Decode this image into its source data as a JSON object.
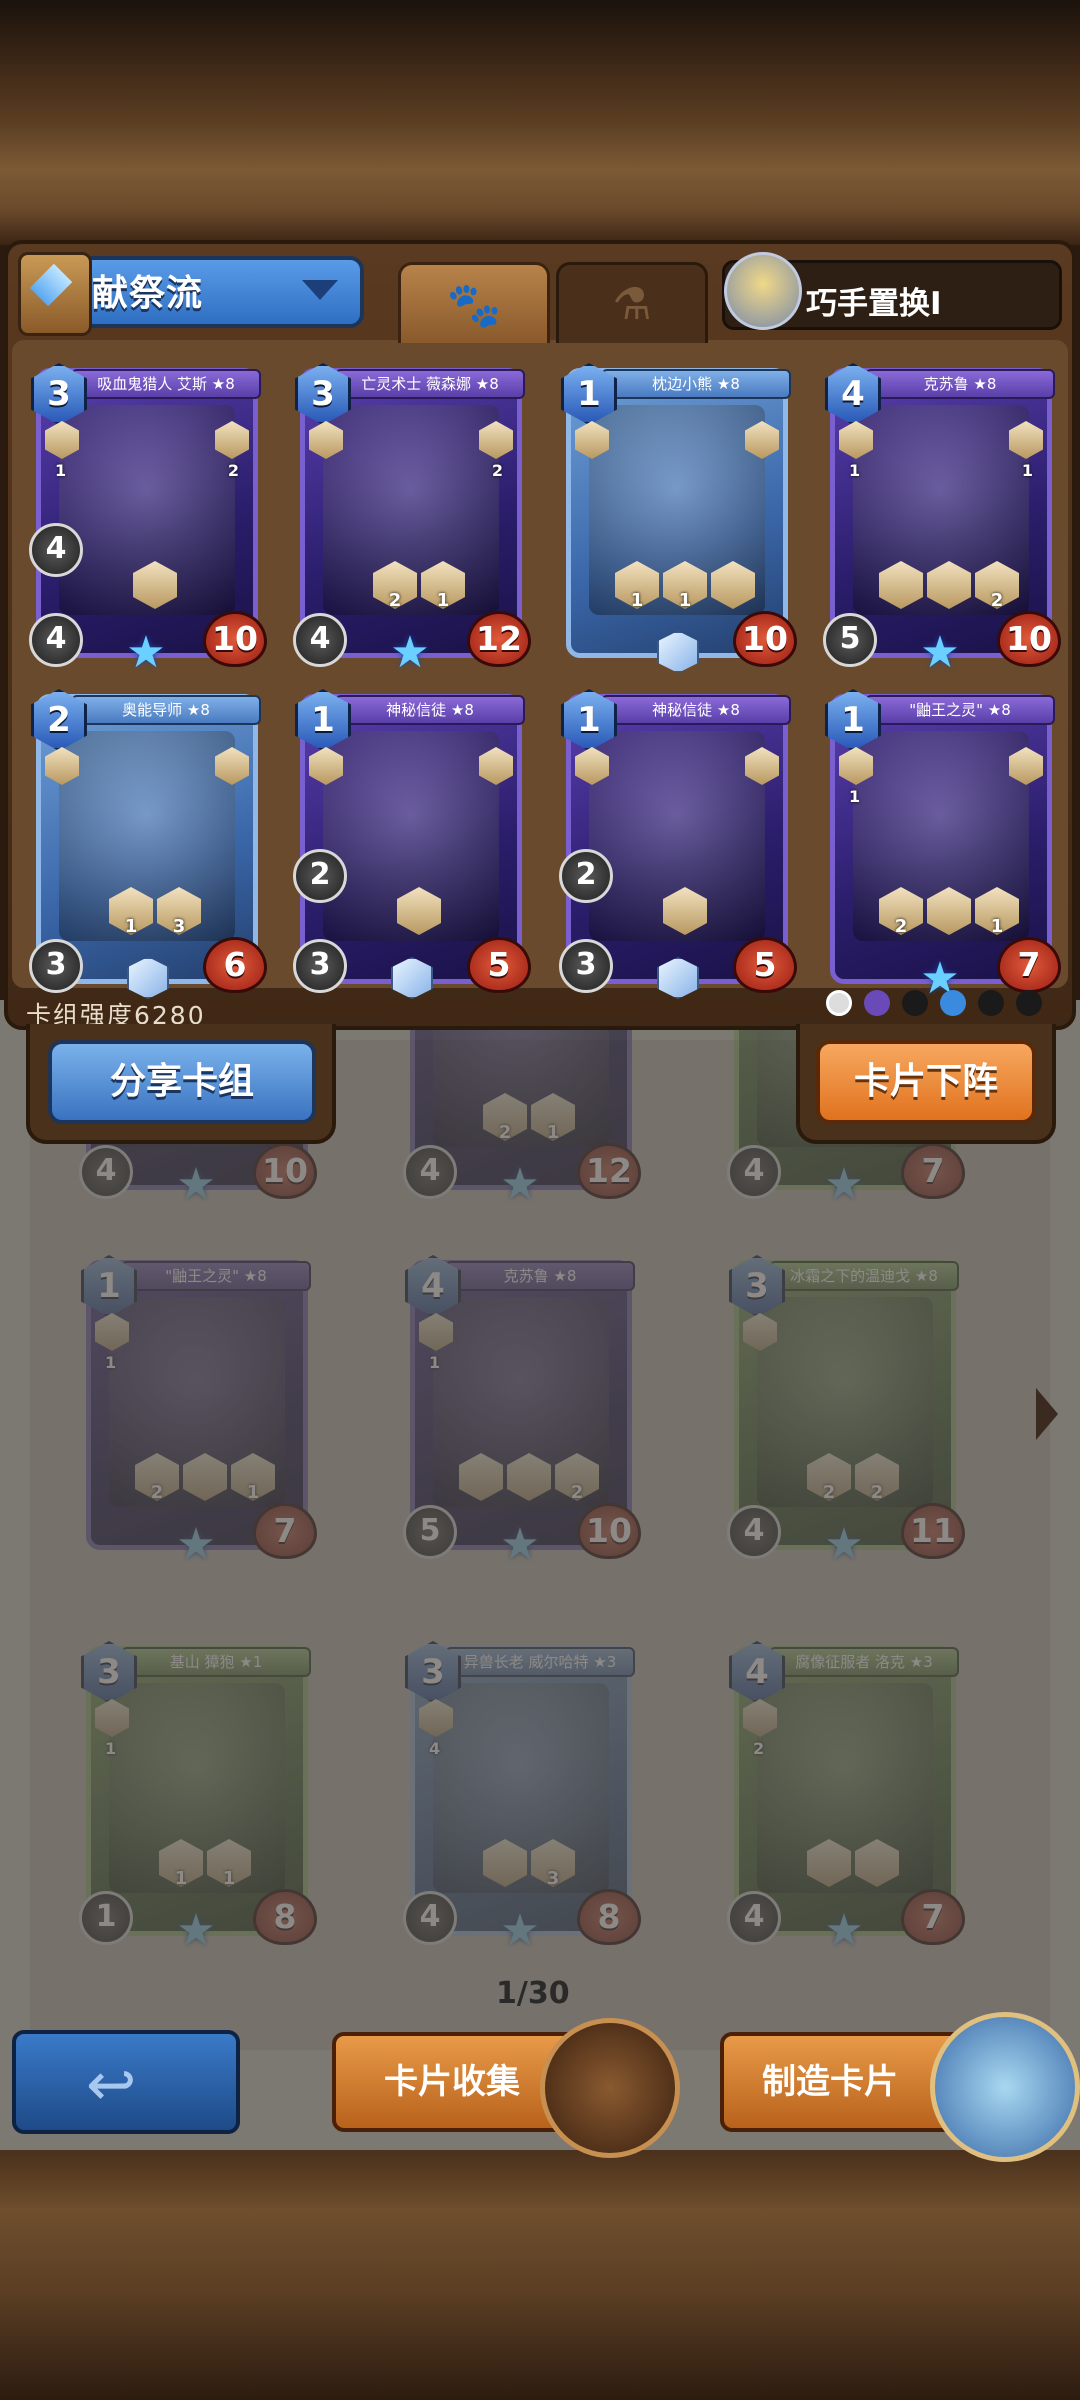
{
  "header": {
    "deck_name": "献祭流",
    "skill_name": "巧手置换I",
    "tabs": [
      {
        "icon": "paw-icon"
      },
      {
        "icon": "potion-icon"
      }
    ]
  },
  "deck_cards": [
    {
      "name": "吸血鬼猎人 艾斯 ★8",
      "cost": "3",
      "atk": "4",
      "hp": "10",
      "mid": "4",
      "side_l": "1",
      "side_r": "2",
      "hexes": [
        ""
      ],
      "theme": "purple",
      "foot": "star"
    },
    {
      "name": "亡灵术士 薇森娜 ★8",
      "cost": "3",
      "atk": "4",
      "hp": "12",
      "mid": "",
      "side_l": "",
      "side_r": "2",
      "hexes": [
        "2",
        "1"
      ],
      "theme": "purple",
      "foot": "star"
    },
    {
      "name": "枕边小熊 ★8",
      "cost": "1",
      "atk": "",
      "hp": "10",
      "mid": "",
      "side_l": "",
      "side_r": "",
      "hexes": [
        "1",
        "1",
        ""
      ],
      "theme": "blue",
      "foot": "gem"
    },
    {
      "name": "克苏鲁 ★8",
      "cost": "4",
      "atk": "5",
      "hp": "10",
      "mid": "",
      "side_l": "1",
      "side_r": "1",
      "hexes": [
        "",
        "",
        "2"
      ],
      "theme": "purple",
      "foot": "star"
    },
    {
      "name": "奥能导师 ★8",
      "cost": "2",
      "atk": "3",
      "hp": "6",
      "mid": "",
      "side_l": "",
      "side_r": "",
      "hexes": [
        "1",
        "3"
      ],
      "theme": "blue",
      "foot": "gem"
    },
    {
      "name": "神秘信徒 ★8",
      "cost": "1",
      "atk": "3",
      "hp": "5",
      "mid": "2",
      "side_l": "",
      "side_r": "",
      "hexes": [
        ""
      ],
      "theme": "purple",
      "foot": "gem"
    },
    {
      "name": "神秘信徒 ★8",
      "cost": "1",
      "atk": "3",
      "hp": "5",
      "mid": "2",
      "side_l": "",
      "side_r": "",
      "hexes": [
        ""
      ],
      "theme": "purple",
      "foot": "gem"
    },
    {
      "name": "\"鼬王之灵\" ★8",
      "cost": "1",
      "atk": "",
      "hp": "7",
      "mid": "",
      "side_l": "1",
      "side_r": "",
      "hexes": [
        "2",
        "",
        "1"
      ],
      "theme": "purple",
      "foot": "star"
    }
  ],
  "deck_strength": "卡组强度6280",
  "buttons": {
    "share": "分享卡组",
    "remove": "卡片下阵"
  },
  "collection": {
    "partial_row": [
      {
        "atk": "4",
        "hp": "10",
        "theme": "purple"
      },
      {
        "atk": "4",
        "hp": "12",
        "hexes": [
          "2",
          "1"
        ],
        "theme": "purple"
      },
      {
        "atk": "4",
        "hp": "7",
        "theme": "green"
      }
    ],
    "cards": [
      {
        "name": "\"鼬王之灵\" ★8",
        "cost": "1",
        "atk": "",
        "hp": "7",
        "side_l": "1",
        "hexes": [
          "2",
          "",
          "1"
        ],
        "theme": "purple"
      },
      {
        "name": "克苏鲁 ★8",
        "cost": "4",
        "atk": "5",
        "hp": "10",
        "side_l": "1",
        "hexes": [
          "",
          "",
          "2"
        ],
        "theme": "purple"
      },
      {
        "name": "冰霜之下的温迪戈 ★8",
        "cost": "3",
        "atk": "4",
        "hp": "11",
        "side_l": "",
        "hexes": [
          "2",
          "2"
        ],
        "theme": "green"
      },
      {
        "name": "基山 獐狍 ★1",
        "cost": "3",
        "atk": "1",
        "hp": "8",
        "side_l": "1",
        "hexes": [
          "1",
          "1"
        ],
        "theme": "green"
      },
      {
        "name": "异兽长老 威尔哈特 ★3",
        "cost": "3",
        "atk": "4",
        "hp": "8",
        "side_l": "4",
        "hexes": [
          "",
          "3"
        ],
        "theme": "blue"
      },
      {
        "name": "腐像征服者 洛克 ★3",
        "cost": "4",
        "atk": "4",
        "hp": "7",
        "side_l": "2",
        "hexes": [
          "",
          ""
        ],
        "theme": "green"
      }
    ],
    "page": "1/30"
  },
  "nav": {
    "collect": "卡片收集",
    "craft": "制造卡片"
  }
}
